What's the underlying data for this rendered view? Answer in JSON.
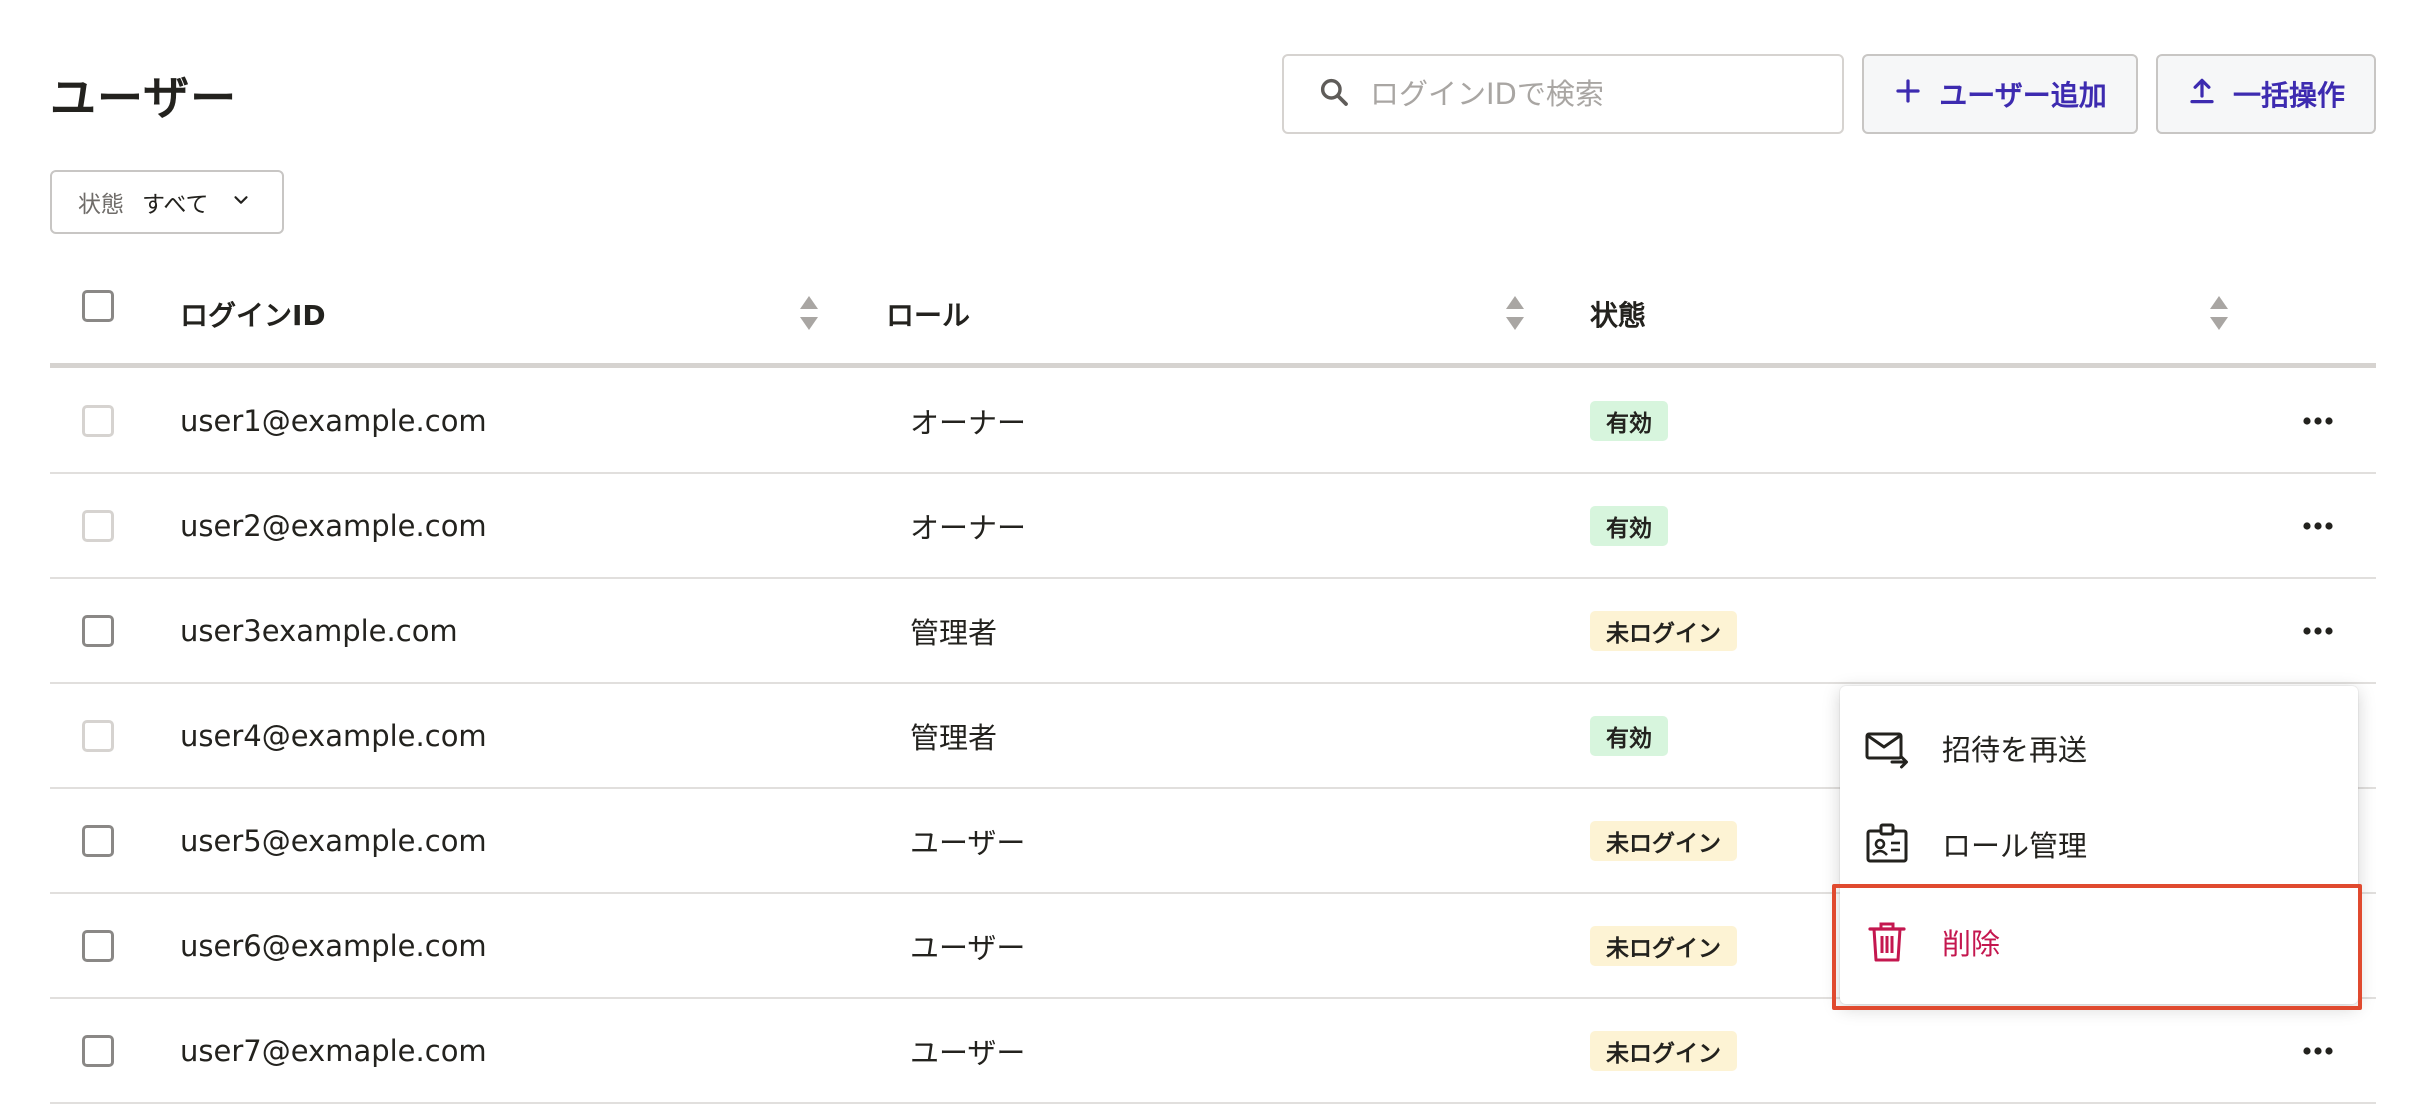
{
  "page": {
    "title": "ユーザー"
  },
  "search": {
    "placeholder": "ログインIDで検索",
    "icon": "search-icon"
  },
  "toolbar": {
    "add_user_label": "ユーザー追加",
    "bulk_label": "一括操作"
  },
  "filter": {
    "label": "状態",
    "value": "すべて"
  },
  "table": {
    "columns": [
      "ログインID",
      "ロール",
      "状態"
    ],
    "rows": [
      {
        "id": "user1@example.com",
        "role": "オーナー",
        "status": "有効",
        "status_type": "active",
        "checkbox_disabled": true,
        "has_menu_button": true
      },
      {
        "id": "user2@example.com",
        "role": "オーナー",
        "status": "有効",
        "status_type": "active",
        "checkbox_disabled": true,
        "has_menu_button": true
      },
      {
        "id": "user3example.com",
        "role": "管理者",
        "status": "未ログイン",
        "status_type": "pending",
        "checkbox_disabled": false,
        "has_menu_button": true
      },
      {
        "id": "user4@example.com",
        "role": "管理者",
        "status": "有効",
        "status_type": "active",
        "checkbox_disabled": true,
        "has_menu_button": false
      },
      {
        "id": "user5@example.com",
        "role": "ユーザー",
        "status": "未ログイン",
        "status_type": "pending",
        "checkbox_disabled": false,
        "has_menu_button": false
      },
      {
        "id": "user6@example.com",
        "role": "ユーザー",
        "status": "未ログイン",
        "status_type": "pending",
        "checkbox_disabled": false,
        "has_menu_button": false
      },
      {
        "id": "user7@exmaple.com",
        "role": "ユーザー",
        "status": "未ログイン",
        "status_type": "pending",
        "checkbox_disabled": false,
        "has_menu_button": true
      }
    ]
  },
  "menu": {
    "items": [
      {
        "label": "招待を再送",
        "icon": "mail-forward-icon"
      },
      {
        "label": "ロール管理",
        "icon": "id-badge-icon"
      },
      {
        "label": "削除",
        "icon": "trash-icon",
        "danger": true
      }
    ]
  },
  "colors": {
    "accent": "#3d2bb0",
    "danger": "#c4174f",
    "badge_active": "#d7f5dd",
    "badge_pending": "#fdf3d4",
    "highlight": "#e04a2f"
  }
}
